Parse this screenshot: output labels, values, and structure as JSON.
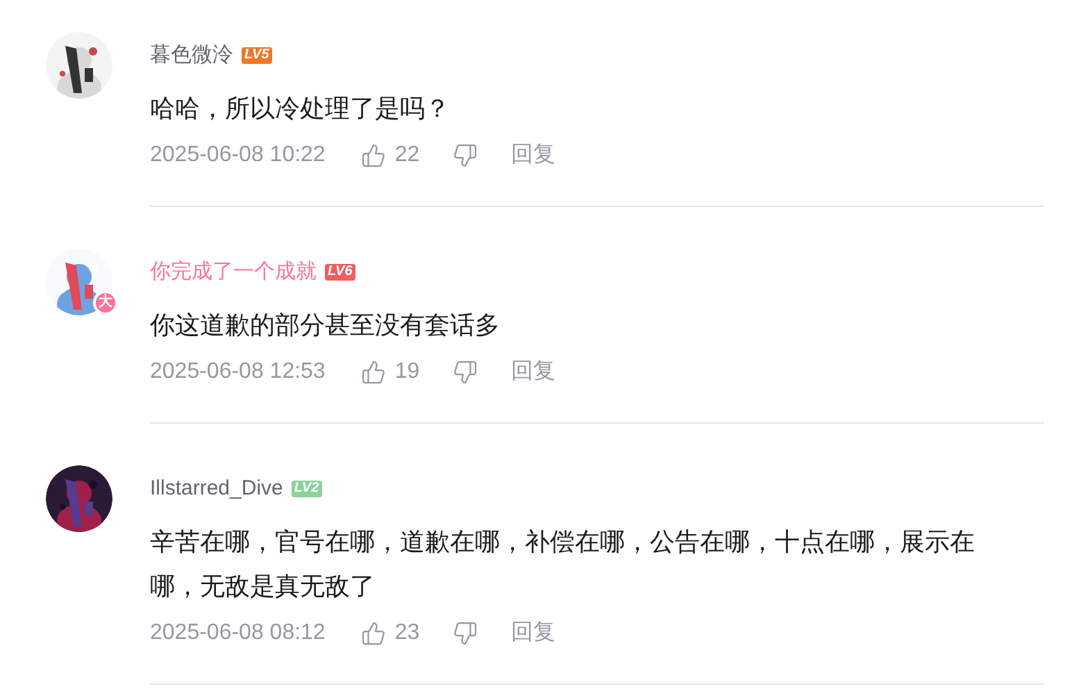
{
  "comments": [
    {
      "user": {
        "name": "暮色微泠",
        "highlighted": false,
        "level": "LV5",
        "color": "#f0772a"
      },
      "text": "哈哈，所以冷处理了是吗？",
      "time": "2025-06-08 10:22",
      "likes": "22",
      "reply": "回复"
    },
    {
      "user": {
        "name": "你完成了一个成就",
        "highlighted": true,
        "level": "LV6",
        "color": "#f25d5d"
      },
      "avatar": {
        "badge": "大"
      },
      "text": "你这道歉的部分甚至没有套话多",
      "time": "2025-06-08 12:53",
      "likes": "19",
      "reply": "回复"
    },
    {
      "user": {
        "name": "Illstarred_Dive",
        "highlighted": false,
        "level": "LV2",
        "color": "#8bd29b"
      },
      "text": "辛苦在哪，官号在哪，道歉在哪，补偿在哪，公告在哪，十点在哪，展示在哪，无敌是真无敌了",
      "time": "2025-06-08 08:12",
      "likes": "23",
      "reply": "回复"
    }
  ]
}
